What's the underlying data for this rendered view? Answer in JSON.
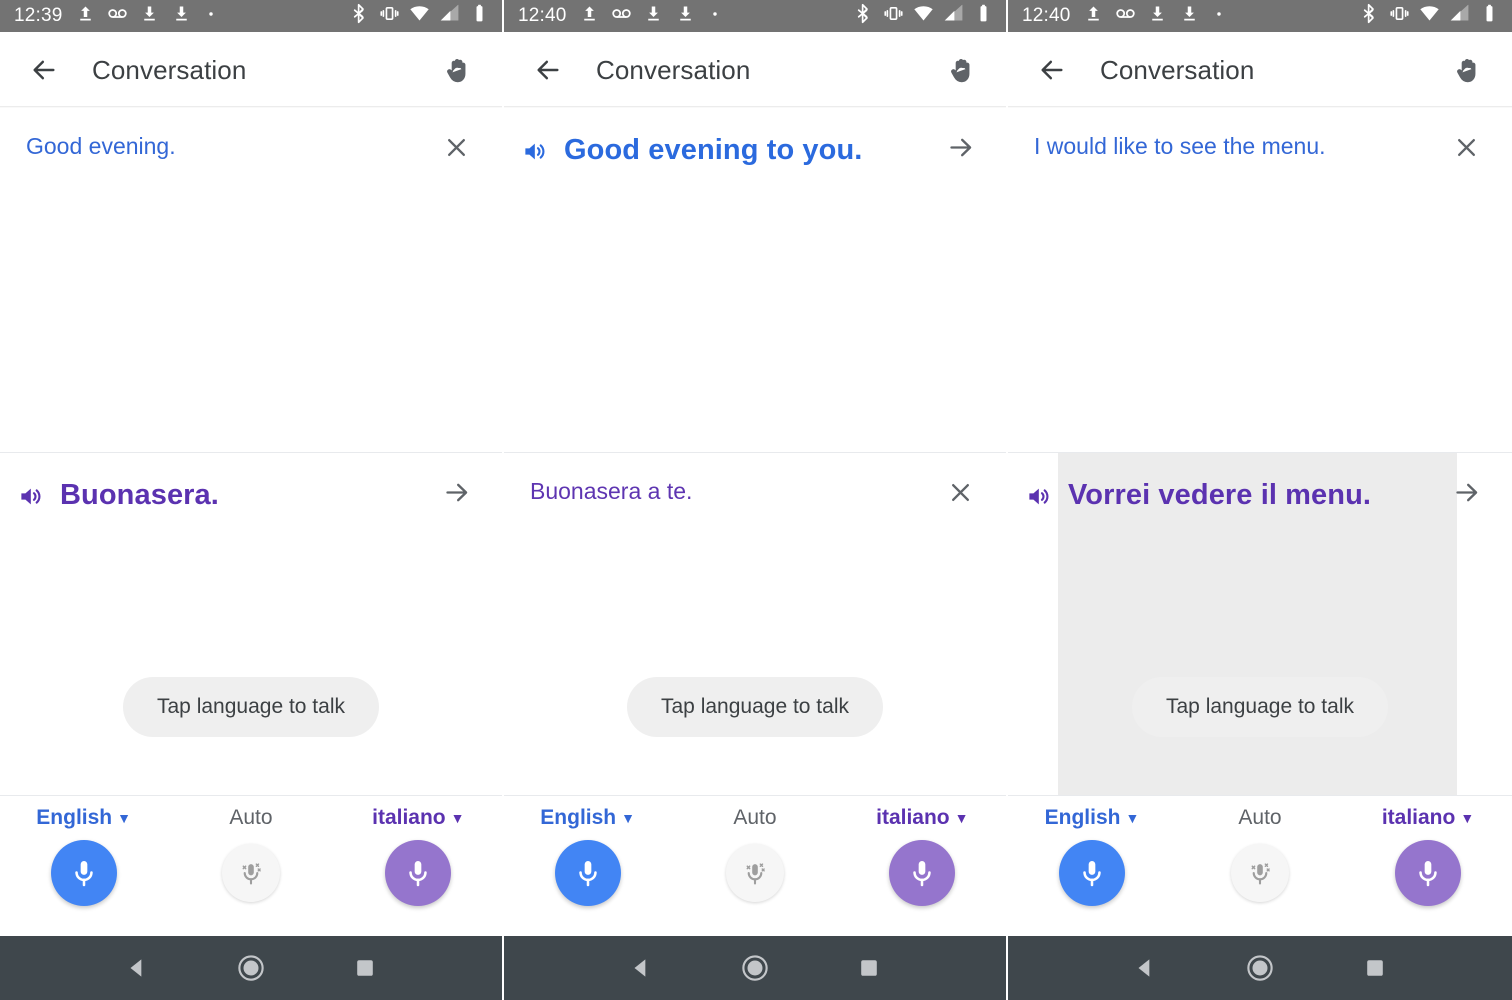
{
  "colors": {
    "status_bar_bg": "#737373",
    "nav_bar_bg": "#3f474c",
    "blue_accent": "#3367d6",
    "blue_mic": "#4285f4",
    "purple_accent": "#5b32b0",
    "purple_mic": "#9575cd",
    "ripple_highlight": "#ececec",
    "tooltip_bg": "#efefef",
    "title_text": "#3c4043"
  },
  "panels": [
    {
      "status": {
        "time": "12:39",
        "left_icons": [
          "upload-icon",
          "voicemail-icon",
          "download-icon",
          "download-icon",
          "dot-icon"
        ],
        "right_icons": [
          "bluetooth-icon",
          "vibrate-icon",
          "wifi-icon",
          "cellular-signal-icon",
          "battery-icon"
        ]
      },
      "appbar": {
        "back_label": "back-arrow",
        "title": "Conversation",
        "hand_label": "hand-raise"
      },
      "top": {
        "text": "Good evening.",
        "style": "small",
        "color_class": "blue",
        "has_speaker": false,
        "action": "close",
        "highlighted": false
      },
      "bottom": {
        "text": "Buonasera.",
        "style": "large",
        "color_class": "purple",
        "has_speaker": true,
        "action": "forward",
        "highlighted": false
      },
      "tooltip": "Tap language to talk",
      "controls": {
        "left": {
          "label": "English",
          "caret": "▼",
          "mic": "mic-icon"
        },
        "center": {
          "label": "Auto",
          "caret": "",
          "mic": "auto-mic-icon"
        },
        "right": {
          "label": "italiano",
          "caret": "▼",
          "mic": "mic-icon"
        }
      },
      "nav": [
        "back-triangle-icon",
        "home-circle-icon",
        "recents-square-icon"
      ]
    },
    {
      "status": {
        "time": "12:40",
        "left_icons": [
          "upload-icon",
          "voicemail-icon",
          "download-icon",
          "download-icon",
          "dot-icon"
        ],
        "right_icons": [
          "bluetooth-icon",
          "vibrate-icon",
          "wifi-icon",
          "cellular-signal-icon",
          "battery-icon"
        ]
      },
      "appbar": {
        "back_label": "back-arrow",
        "title": "Conversation",
        "hand_label": "hand-raise"
      },
      "top": {
        "text": "Good evening to you.",
        "style": "large",
        "color_class": "blue-bold",
        "has_speaker": true,
        "action": "forward",
        "highlighted": false
      },
      "bottom": {
        "text": "Buonasera a te.",
        "style": "small",
        "color_class": "purple-light",
        "has_speaker": false,
        "action": "close",
        "highlighted": false
      },
      "tooltip": "Tap language to talk",
      "controls": {
        "left": {
          "label": "English",
          "caret": "▼",
          "mic": "mic-icon"
        },
        "center": {
          "label": "Auto",
          "caret": "",
          "mic": "auto-mic-icon"
        },
        "right": {
          "label": "italiano",
          "caret": "▼",
          "mic": "mic-icon"
        }
      },
      "nav": [
        "back-triangle-icon",
        "home-circle-icon",
        "recents-square-icon"
      ]
    },
    {
      "status": {
        "time": "12:40",
        "left_icons": [
          "upload-icon",
          "voicemail-icon",
          "download-icon",
          "download-icon",
          "dot-icon"
        ],
        "right_icons": [
          "bluetooth-icon",
          "vibrate-icon",
          "wifi-icon",
          "cellular-signal-icon",
          "battery-icon"
        ]
      },
      "appbar": {
        "back_label": "back-arrow",
        "title": "Conversation",
        "hand_label": "hand-raise"
      },
      "top": {
        "text": "I would like to see the menu.",
        "style": "small",
        "color_class": "blue",
        "has_speaker": false,
        "action": "close",
        "highlighted": false
      },
      "bottom": {
        "text": "Vorrei vedere il menu.",
        "style": "large",
        "color_class": "purple",
        "has_speaker": true,
        "action": "forward",
        "highlighted": true
      },
      "tooltip": "Tap language to talk",
      "controls": {
        "left": {
          "label": "English",
          "caret": "▼",
          "mic": "mic-icon"
        },
        "center": {
          "label": "Auto",
          "caret": "",
          "mic": "auto-mic-icon"
        },
        "right": {
          "label": "italiano",
          "caret": "▼",
          "mic": "mic-icon"
        }
      },
      "nav": [
        "back-triangle-icon",
        "home-circle-icon",
        "recents-square-icon"
      ]
    }
  ]
}
